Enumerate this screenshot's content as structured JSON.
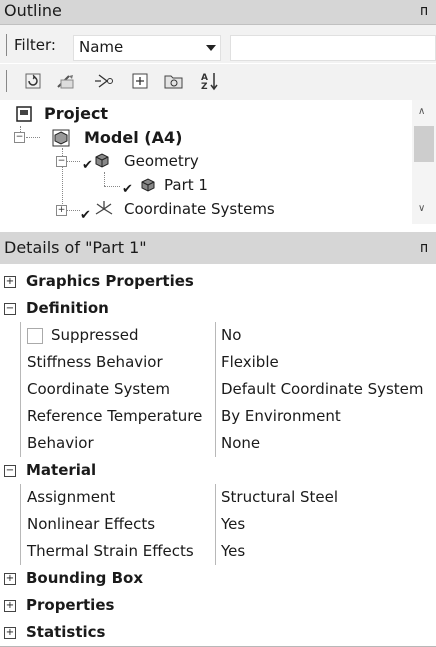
{
  "outline": {
    "title": "Outline",
    "pin": "ᴨ",
    "filter_label": "Filter:",
    "filter_value": "Name",
    "toolbar_icons": [
      "refresh-icon",
      "wand-icon",
      "graph-icon",
      "expand-all-icon",
      "folder-icon",
      "sort-az-icon"
    ],
    "tree": {
      "project": "Project",
      "model": "Model (A4)",
      "geometry": "Geometry",
      "part": "Part 1",
      "coordinate_systems": "Coordinate Systems"
    }
  },
  "details": {
    "title": "Details of \"Part 1\"",
    "pin": "ᴨ",
    "rows": [
      {
        "kind": "category",
        "expander": "+",
        "label": "Graphics Properties"
      },
      {
        "kind": "category",
        "expander": "−",
        "label": "Definition"
      },
      {
        "kind": "prop",
        "name": "Suppressed",
        "value": "No",
        "checkbox": true
      },
      {
        "kind": "prop",
        "name": "Stiffness Behavior",
        "value": "Flexible"
      },
      {
        "kind": "prop",
        "name": "Coordinate System",
        "value": "Default Coordinate System"
      },
      {
        "kind": "prop",
        "name": "Reference Temperature",
        "value": "By Environment"
      },
      {
        "kind": "prop",
        "name": "Behavior",
        "value": "None"
      },
      {
        "kind": "category",
        "expander": "−",
        "label": "Material"
      },
      {
        "kind": "prop",
        "name": "Assignment",
        "value": "Structural Steel"
      },
      {
        "kind": "prop",
        "name": "Nonlinear Effects",
        "value": "Yes"
      },
      {
        "kind": "prop",
        "name": "Thermal Strain Effects",
        "value": "Yes"
      },
      {
        "kind": "category",
        "expander": "+",
        "label": "Bounding Box"
      },
      {
        "kind": "category",
        "expander": "+",
        "label": "Properties"
      },
      {
        "kind": "category",
        "expander": "+",
        "label": "Statistics"
      }
    ]
  }
}
